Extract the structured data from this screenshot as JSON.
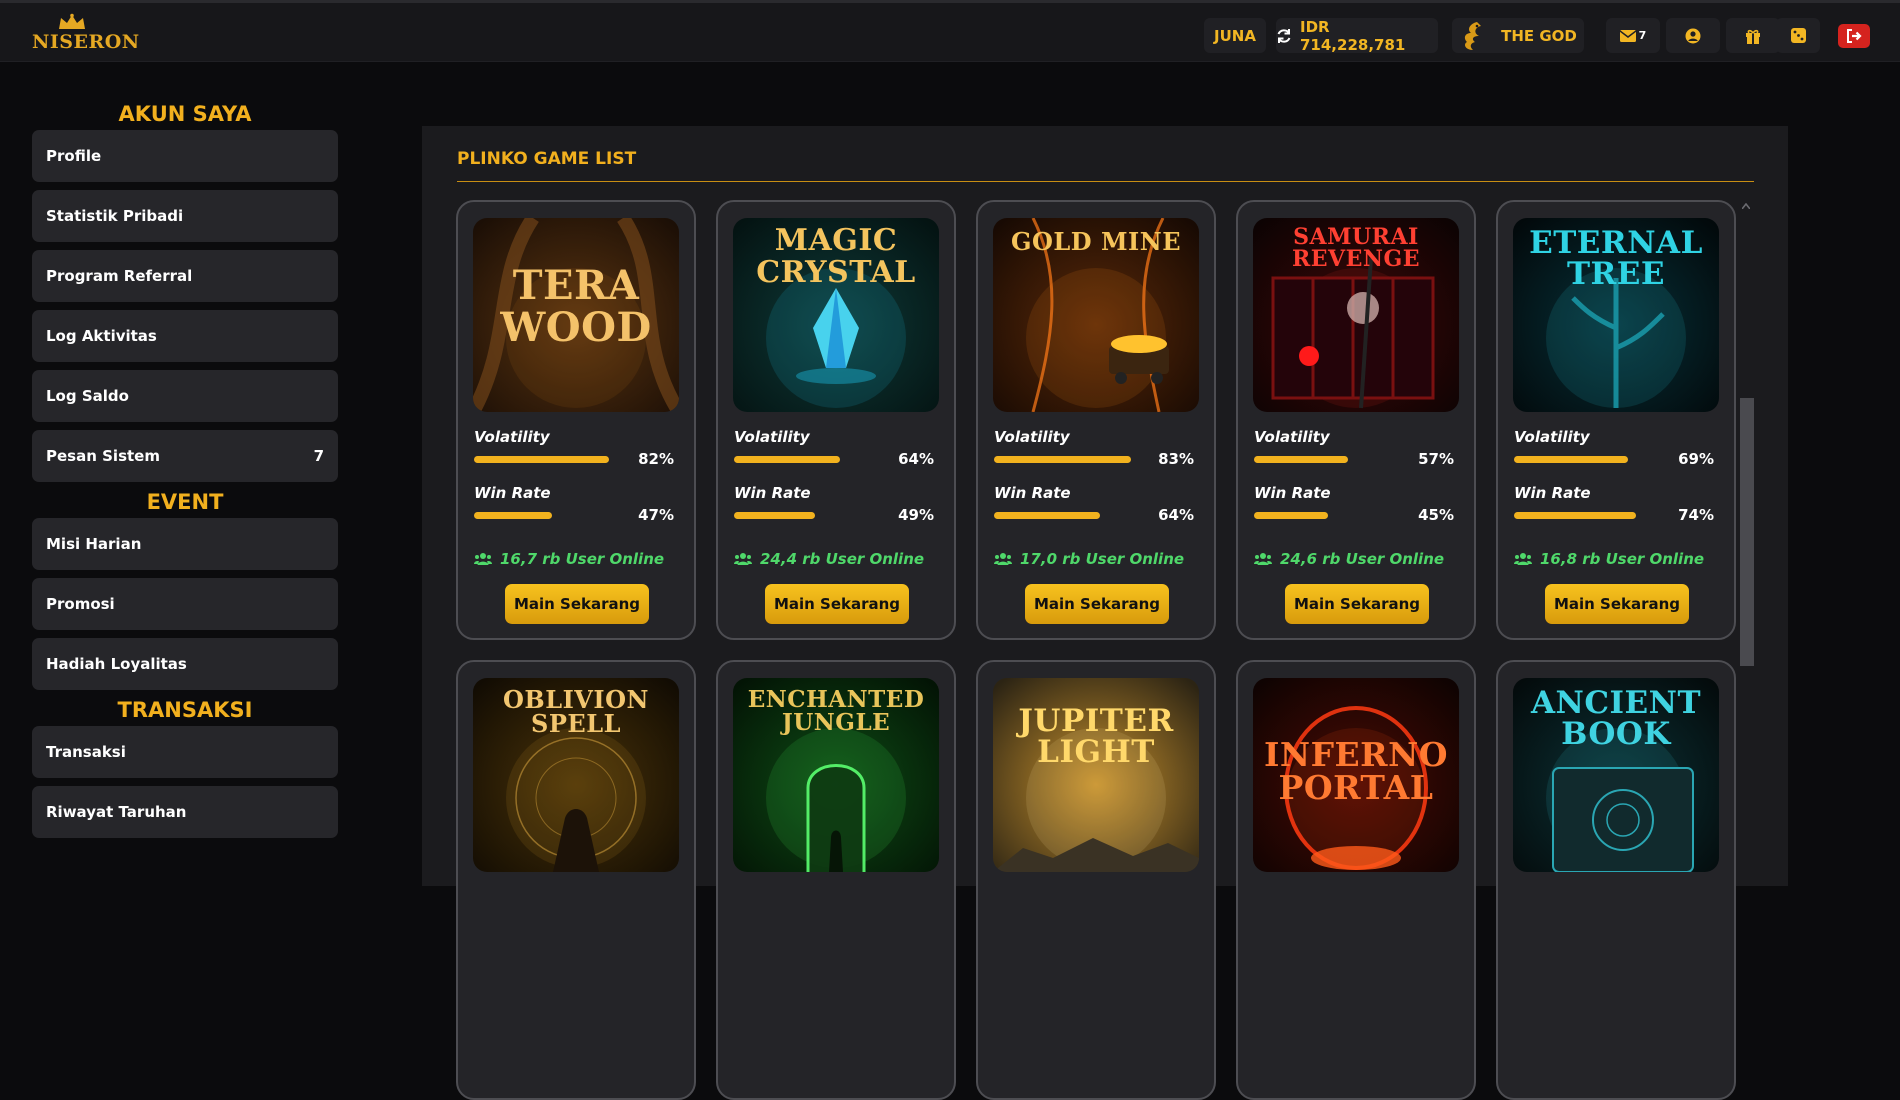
{
  "logo": {
    "text": "NISERON"
  },
  "header": {
    "username": "JUNA",
    "balance": "IDR 714,228,781",
    "rank": "THE GOD",
    "messages_count": "7",
    "icons": [
      "refresh-icon",
      "dragon-icon",
      "mail-icon",
      "user-icon",
      "gift-icon",
      "dice-icon",
      "logout-icon"
    ]
  },
  "sidebar": {
    "account_title": "AKUN SAYA",
    "account_items": [
      {
        "label": "Profile"
      },
      {
        "label": "Statistik Pribadi"
      },
      {
        "label": "Program Referral"
      },
      {
        "label": "Log Aktivitas"
      },
      {
        "label": "Log Saldo"
      },
      {
        "label": "Pesan Sistem",
        "count": "7"
      }
    ],
    "event_title": "EVENT",
    "event_items": [
      {
        "label": "Misi Harian"
      },
      {
        "label": "Promosi"
      },
      {
        "label": "Hadiah Loyalitas"
      }
    ],
    "transaction_title": "TRANSAKSI",
    "transaction_items": [
      {
        "label": "Transaksi"
      },
      {
        "label": "Riwayat Taruhan"
      }
    ]
  },
  "main": {
    "title": "PLINKO GAME LIST",
    "labels": {
      "volatility": "Volatility",
      "win_rate": "Win Rate",
      "play": "Main Sekarang"
    },
    "games": [
      {
        "title_line1": "TERA",
        "title_line2": "WOOD",
        "volatility": "82%",
        "win_rate": "47%",
        "volatility_pct": 82,
        "win_rate_pct": 47,
        "online": "16,7 rb User Online",
        "theme": "wood"
      },
      {
        "title_line1": "MAGIC",
        "title_line2": "CRYSTAL",
        "volatility": "64%",
        "win_rate": "49%",
        "volatility_pct": 64,
        "win_rate_pct": 49,
        "online": "24,4 rb User Online",
        "theme": "crystal"
      },
      {
        "title_line1": "GOLD MINE",
        "title_line2": "",
        "volatility": "83%",
        "win_rate": "64%",
        "volatility_pct": 83,
        "win_rate_pct": 64,
        "online": "17,0 rb User Online",
        "theme": "mine"
      },
      {
        "title_line1": "SAMURAI",
        "title_line2": "REVENGE",
        "volatility": "57%",
        "win_rate": "45%",
        "volatility_pct": 57,
        "win_rate_pct": 45,
        "online": "24,6 rb User Online",
        "theme": "samurai"
      },
      {
        "title_line1": "ETERNAL",
        "title_line2": "TREE",
        "volatility": "69%",
        "win_rate": "74%",
        "volatility_pct": 69,
        "win_rate_pct": 74,
        "online": "16,8 rb User Online",
        "theme": "tree"
      },
      {
        "title_line1": "OBLIVION",
        "title_line2": "SPELL",
        "theme": "spell"
      },
      {
        "title_line1": "ENCHANTED",
        "title_line2": "JUNGLE",
        "theme": "jungle"
      },
      {
        "title_line1": "JUPITER",
        "title_line2": "LIGHT",
        "theme": "jupiter"
      },
      {
        "title_line1": "INFERNO",
        "title_line2": "PORTAL",
        "theme": "inferno"
      },
      {
        "title_line1": "ANCIENT",
        "title_line2": "BOOK",
        "theme": "book"
      }
    ]
  },
  "colors": {
    "accent": "#f2b01e",
    "online": "#4fd86a",
    "logout": "#d5231e",
    "panel": "#1b1b1e",
    "card": "#242428"
  }
}
